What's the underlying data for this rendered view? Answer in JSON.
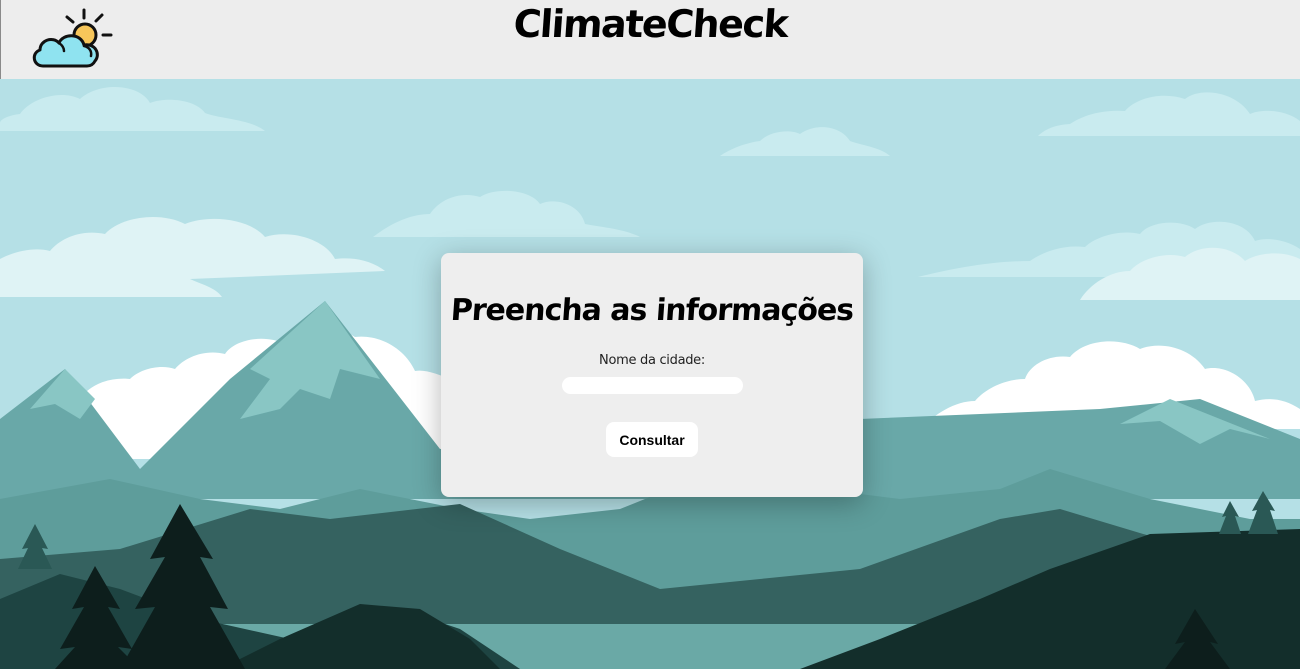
{
  "header": {
    "title": "ClimateCheck",
    "logo_icon": "cloud-sun-icon"
  },
  "form": {
    "title": "Preencha as informações",
    "city_label": "Nome da cidade:",
    "city_value": "",
    "submit_label": "Consultar"
  },
  "colors": {
    "header_bg": "#ededed",
    "sky": "#b5e0e6",
    "card_bg": "#eeeeee"
  }
}
